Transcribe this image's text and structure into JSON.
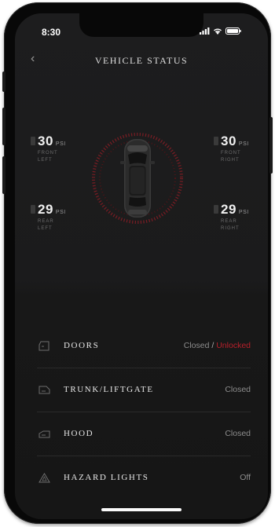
{
  "status_bar": {
    "time": "8:30"
  },
  "header": {
    "back_glyph": "‹",
    "title": "VEHICLE STATUS"
  },
  "tires": {
    "front_left": {
      "value": "30",
      "unit": "PSI",
      "pos1": "FRONT",
      "pos2": "LEFT"
    },
    "front_right": {
      "value": "30",
      "unit": "PSI",
      "pos1": "FRONT",
      "pos2": "RIGHT"
    },
    "rear_left": {
      "value": "29",
      "unit": "PSI",
      "pos1": "REAR",
      "pos2": "LEFT"
    },
    "rear_right": {
      "value": "29",
      "unit": "PSI",
      "pos1": "REAR",
      "pos2": "RIGHT"
    }
  },
  "status_rows": [
    {
      "label": "DOORS",
      "value": "Closed",
      "separator": "/",
      "alert": "Unlocked",
      "icon": "door-icon"
    },
    {
      "label": "TRUNK/LIFTGATE",
      "value": "Closed",
      "icon": "trunk-icon"
    },
    {
      "label": "HOOD",
      "value": "Closed",
      "icon": "hood-icon"
    },
    {
      "label": "HAZARD LIGHTS",
      "value": "Off",
      "icon": "hazard-icon"
    }
  ],
  "colors": {
    "accent_red": "#b8202b",
    "background": "#1b1b1c"
  }
}
